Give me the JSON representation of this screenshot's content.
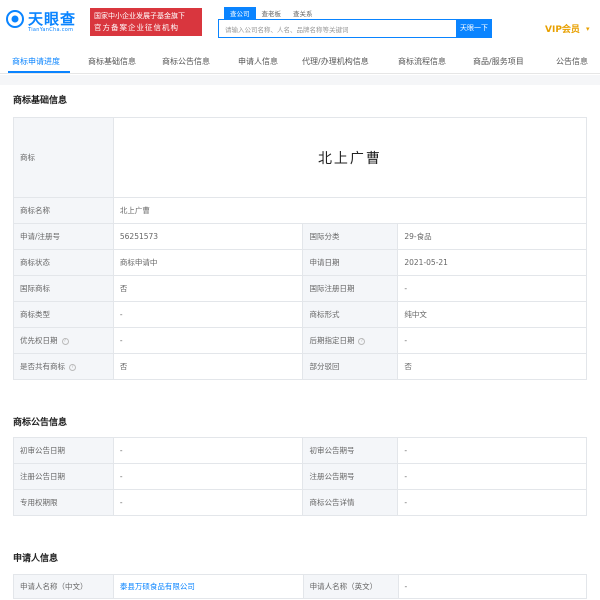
{
  "header": {
    "logo_text": "天眼查",
    "logo_sub": "TianYanCha.com",
    "promo_line1": "国家中小企业发展子基金旗下",
    "promo_line2": "官方备案企业征信机构",
    "search_tabs": [
      "查公司",
      "查老板",
      "查关系"
    ],
    "search_placeholder": "请输入公司名称、人名、品牌名称等关键词",
    "search_button": "天眼一下",
    "vip_label": "VIP会员",
    "colors": {
      "accent": "#0a84ff",
      "promo": "#d9363e",
      "vip": "#e8a000"
    }
  },
  "nav": {
    "tabs": [
      "商标申请进度",
      "商标基础信息",
      "商标公告信息",
      "申请人信息",
      "代理/办理机构信息",
      "商标流程信息",
      "商品/服务项目",
      "公告信息"
    ],
    "active_index": 0
  },
  "basic": {
    "title": "商标基础信息",
    "trademark_label": "商标",
    "trademark_image_text": "北上广曹",
    "name_label": "商标名称",
    "name_value": "北上广曹",
    "rows": [
      {
        "l1": "申请/注册号",
        "v1": "56251573",
        "l2": "国际分类",
        "v2": "29-食品"
      },
      {
        "l1": "商标状态",
        "v1": "商标申请中",
        "l2": "申请日期",
        "v2": "2021-05-21"
      },
      {
        "l1": "国际商标",
        "v1": "否",
        "l2": "国际注册日期",
        "v2": "-"
      },
      {
        "l1": "商标类型",
        "v1": "-",
        "l2": "商标形式",
        "v2": "纯中文"
      },
      {
        "l1": "优先权日期",
        "v1": "-",
        "l2": "后期指定日期",
        "v2": "-"
      },
      {
        "l1": "是否共有商标",
        "v1": "否",
        "l2": "部分驳回",
        "v2": "否"
      }
    ]
  },
  "notice": {
    "title": "商标公告信息",
    "rows": [
      {
        "l1": "初审公告日期",
        "v1": "-",
        "l2": "初审公告期号",
        "v2": "-"
      },
      {
        "l1": "注册公告日期",
        "v1": "-",
        "l2": "注册公告期号",
        "v2": "-"
      },
      {
        "l1": "专用权期限",
        "v1": "-",
        "l2": "商标公告详情",
        "v2": "-"
      }
    ]
  },
  "applicant": {
    "title": "申请人信息",
    "name_cn_label": "申请人名称（中文）",
    "name_cn_value": "泰县万硕食品有限公司",
    "name_en_label": "申请人名称（英文）",
    "name_en_value": "-"
  }
}
